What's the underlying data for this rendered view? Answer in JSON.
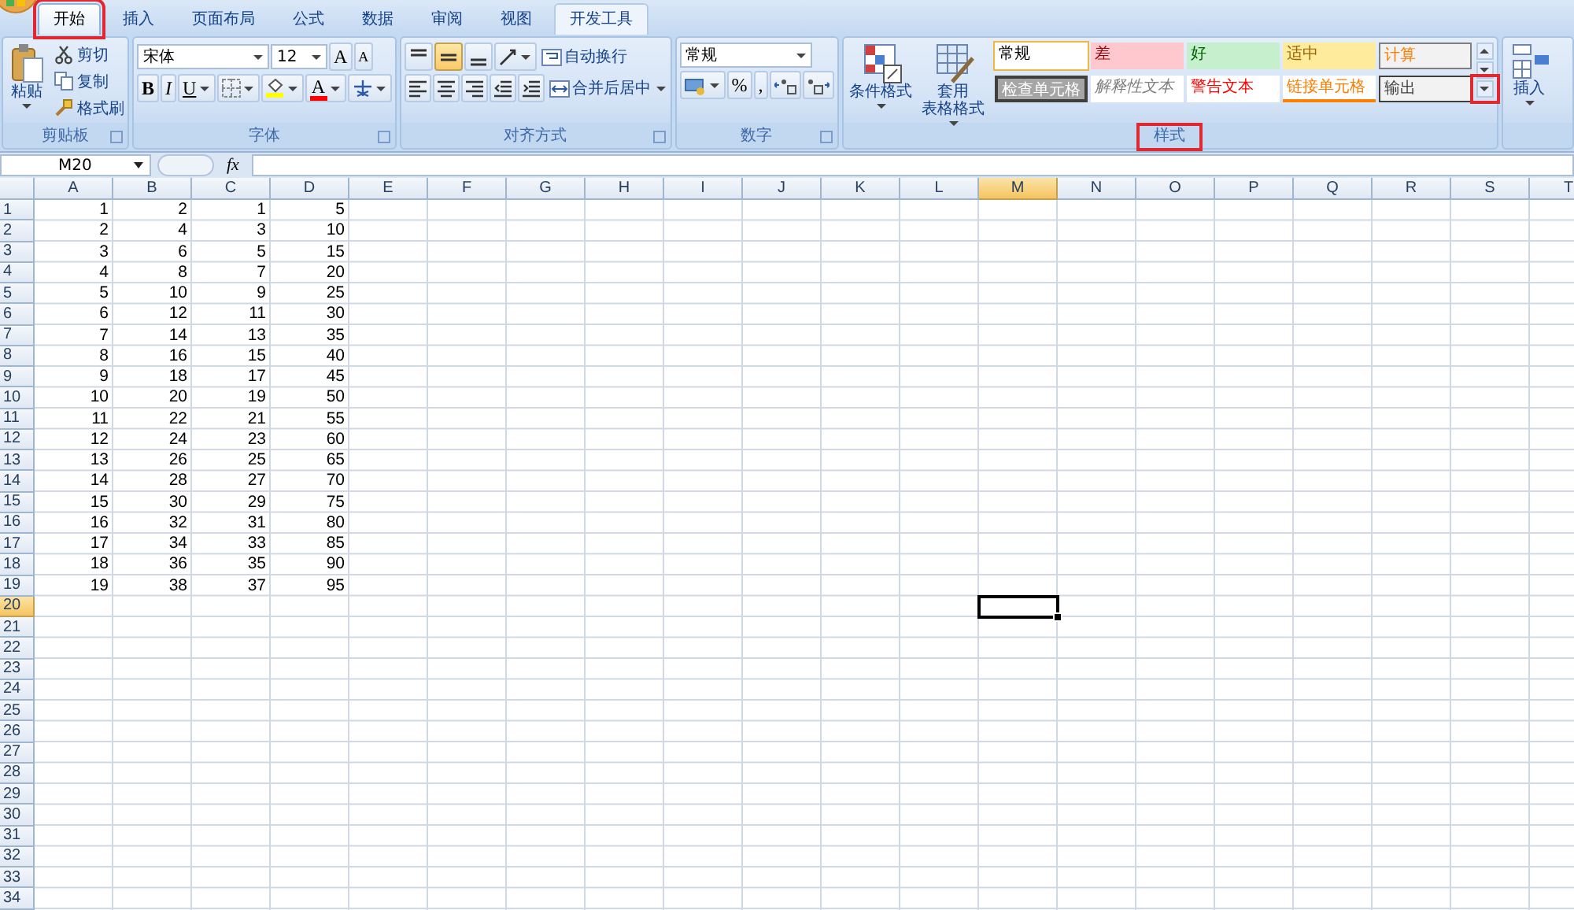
{
  "tabs": [
    {
      "label": "开始",
      "selected": true,
      "highlighted": true,
      "hovered": false
    },
    {
      "label": "插入",
      "selected": false,
      "highlighted": false,
      "hovered": false
    },
    {
      "label": "页面布局",
      "selected": false,
      "highlighted": false,
      "hovered": false
    },
    {
      "label": "公式",
      "selected": false,
      "highlighted": false,
      "hovered": false
    },
    {
      "label": "数据",
      "selected": false,
      "highlighted": false,
      "hovered": false
    },
    {
      "label": "审阅",
      "selected": false,
      "highlighted": false,
      "hovered": false
    },
    {
      "label": "视图",
      "selected": false,
      "highlighted": false,
      "hovered": false
    },
    {
      "label": "开发工具",
      "selected": false,
      "highlighted": false,
      "hovered": true
    }
  ],
  "ribbon": {
    "groups": [
      {
        "label": "剪贴板",
        "launcher": true,
        "highlighted": false,
        "big": [
          {
            "kind": "big",
            "lines": [
              "粘贴"
            ],
            "dropdown": true
          }
        ],
        "rows": [
          {
            "items": [
              {
                "kind": "small",
                "label": "剪切"
              }
            ]
          },
          {
            "items": [
              {
                "kind": "small",
                "label": "复制"
              }
            ]
          },
          {
            "items": [
              {
                "kind": "small",
                "label": "格式刷"
              }
            ]
          }
        ]
      },
      {
        "label": "字体",
        "launcher": true,
        "highlighted": false,
        "rows": [
          {
            "items": [
              {
                "kind": "combo",
                "value": "宋体"
              },
              {
                "kind": "combo",
                "value": "12"
              },
              {
                "kind": "glyph",
                "text": "A"
              },
              {
                "kind": "glyph",
                "text": "A"
              }
            ]
          },
          {
            "items": [
              {
                "kind": "glyph",
                "text": "B"
              },
              {
                "kind": "glyph",
                "text": "I"
              },
              {
                "kind": "glyph",
                "text": "U",
                "dropdown": true
              },
              {
                "kind": "icon",
                "dropdown": true
              },
              {
                "kind": "icon",
                "dropdown": true,
                "color": "#ffff00"
              },
              {
                "kind": "glyph",
                "text": "A",
                "dropdown": true,
                "color": "#ff0000"
              },
              {
                "kind": "icon",
                "dropdown": true
              }
            ]
          }
        ]
      },
      {
        "label": "对齐方式",
        "launcher": true,
        "highlighted": false,
        "rows": [
          {
            "items": [
              {
                "kind": "icon",
                "selected": false
              },
              {
                "kind": "icon",
                "selected": true
              },
              {
                "kind": "icon",
                "selected": false
              },
              {
                "kind": "icon",
                "dropdown": true
              },
              {
                "kind": "small",
                "label": "自动换行"
              }
            ]
          },
          {
            "items": [
              {
                "kind": "icon"
              },
              {
                "kind": "icon"
              },
              {
                "kind": "icon"
              },
              {
                "kind": "icon"
              },
              {
                "kind": "icon"
              },
              {
                "kind": "small",
                "label": "合并后居中",
                "dropdown": true
              }
            ]
          }
        ]
      },
      {
        "label": "数字",
        "launcher": true,
        "highlighted": false,
        "rows": [
          {
            "items": [
              {
                "kind": "combo",
                "value": "常规"
              }
            ]
          },
          {
            "items": [
              {
                "kind": "icon",
                "dropdown": true
              },
              {
                "kind": "glyph",
                "text": "%"
              },
              {
                "kind": "glyph",
                "text": ","
              },
              {
                "kind": "icon"
              },
              {
                "kind": "icon"
              }
            ]
          }
        ]
      },
      {
        "label": "样式",
        "launcher": false,
        "highlighted": true,
        "big": [
          {
            "kind": "big",
            "lines": [
              "条件格式"
            ],
            "dropdown": true
          },
          {
            "kind": "big",
            "lines": [
              "套用",
              "表格格式"
            ],
            "dropdown": true
          }
        ],
        "gallery": {
          "more_highlighted": true,
          "styles": [
            {
              "label": "常规",
              "color": "#ffffff",
              "selected": true
            },
            {
              "label": "差",
              "color": "#ffc7ce",
              "selected": false
            },
            {
              "label": "好",
              "color": "#c6efce",
              "selected": false
            },
            {
              "label": "适中",
              "color": "#ffeb9c",
              "selected": false
            },
            {
              "label": "计算",
              "color": "#f2f2f2",
              "selected": false
            },
            {
              "label": "检查单元格",
              "color": "#a5a5a5",
              "selected": false
            },
            {
              "label": "解释性文本",
              "color": "#ffffff",
              "selected": false
            },
            {
              "label": "警告文本",
              "color": "#ffffff",
              "selected": false
            },
            {
              "label": "链接单元格",
              "color": "#ffffff",
              "selected": false
            },
            {
              "label": "输出",
              "color": "#f2f2f2",
              "selected": false
            }
          ]
        }
      },
      {
        "big": [
          {
            "kind": "big",
            "lines": [
              "插入"
            ],
            "dropdown": true
          }
        ]
      }
    ]
  },
  "formula_bar": {
    "name_box": "M20",
    "function_label": "fx"
  },
  "sheet": {
    "columns": [
      {
        "label": "A",
        "selected": false
      },
      {
        "label": "B",
        "selected": false
      },
      {
        "label": "C",
        "selected": false
      },
      {
        "label": "D",
        "selected": false
      },
      {
        "label": "E",
        "selected": false
      },
      {
        "label": "F",
        "selected": false
      },
      {
        "label": "G",
        "selected": false
      },
      {
        "label": "H",
        "selected": false
      },
      {
        "label": "I",
        "selected": false
      },
      {
        "label": "J",
        "selected": false
      },
      {
        "label": "K",
        "selected": false
      },
      {
        "label": "L",
        "selected": false
      },
      {
        "label": "M",
        "selected": true
      },
      {
        "label": "N",
        "selected": false
      },
      {
        "label": "O",
        "selected": false
      },
      {
        "label": "P",
        "selected": false
      },
      {
        "label": "Q",
        "selected": false
      },
      {
        "label": "R",
        "selected": false
      },
      {
        "label": "S",
        "selected": false
      },
      {
        "label": "T",
        "selected": false
      }
    ],
    "rows": [
      {
        "label": "1",
        "selected": false,
        "cells": [
          "1",
          "2",
          "1",
          "5"
        ]
      },
      {
        "label": "2",
        "selected": false,
        "cells": [
          "2",
          "4",
          "3",
          "10"
        ]
      },
      {
        "label": "3",
        "selected": false,
        "cells": [
          "3",
          "6",
          "5",
          "15"
        ]
      },
      {
        "label": "4",
        "selected": false,
        "cells": [
          "4",
          "8",
          "7",
          "20"
        ]
      },
      {
        "label": "5",
        "selected": false,
        "cells": [
          "5",
          "10",
          "9",
          "25"
        ]
      },
      {
        "label": "6",
        "selected": false,
        "cells": [
          "6",
          "12",
          "11",
          "30"
        ]
      },
      {
        "label": "7",
        "selected": false,
        "cells": [
          "7",
          "14",
          "13",
          "35"
        ]
      },
      {
        "label": "8",
        "selected": false,
        "cells": [
          "8",
          "16",
          "15",
          "40"
        ]
      },
      {
        "label": "9",
        "selected": false,
        "cells": [
          "9",
          "18",
          "17",
          "45"
        ]
      },
      {
        "label": "10",
        "selected": false,
        "cells": [
          "10",
          "20",
          "19",
          "50"
        ]
      },
      {
        "label": "11",
        "selected": false,
        "cells": [
          "11",
          "22",
          "21",
          "55"
        ]
      },
      {
        "label": "12",
        "selected": false,
        "cells": [
          "12",
          "24",
          "23",
          "60"
        ]
      },
      {
        "label": "13",
        "selected": false,
        "cells": [
          "13",
          "26",
          "25",
          "65"
        ]
      },
      {
        "label": "14",
        "selected": false,
        "cells": [
          "14",
          "28",
          "27",
          "70"
        ]
      },
      {
        "label": "15",
        "selected": false,
        "cells": [
          "15",
          "30",
          "29",
          "75"
        ]
      },
      {
        "label": "16",
        "selected": false,
        "cells": [
          "16",
          "32",
          "31",
          "80"
        ]
      },
      {
        "label": "17",
        "selected": false,
        "cells": [
          "17",
          "34",
          "33",
          "85"
        ]
      },
      {
        "label": "18",
        "selected": false,
        "cells": [
          "18",
          "36",
          "35",
          "90"
        ]
      },
      {
        "label": "19",
        "selected": false,
        "cells": [
          "19",
          "38",
          "37",
          "95"
        ]
      },
      {
        "label": "20",
        "selected": true
      },
      {
        "label": "21",
        "selected": false
      },
      {
        "label": "22",
        "selected": false
      },
      {
        "label": "23",
        "selected": false
      },
      {
        "label": "24",
        "selected": false
      },
      {
        "label": "25",
        "selected": false
      },
      {
        "label": "26",
        "selected": false
      },
      {
        "label": "27",
        "selected": false
      },
      {
        "label": "28",
        "selected": false
      },
      {
        "label": "29",
        "selected": false
      },
      {
        "label": "30",
        "selected": false
      },
      {
        "label": "31",
        "selected": false
      },
      {
        "label": "32",
        "selected": false
      },
      {
        "label": "33",
        "selected": false
      },
      {
        "label": "34",
        "selected": false
      }
    ]
  }
}
